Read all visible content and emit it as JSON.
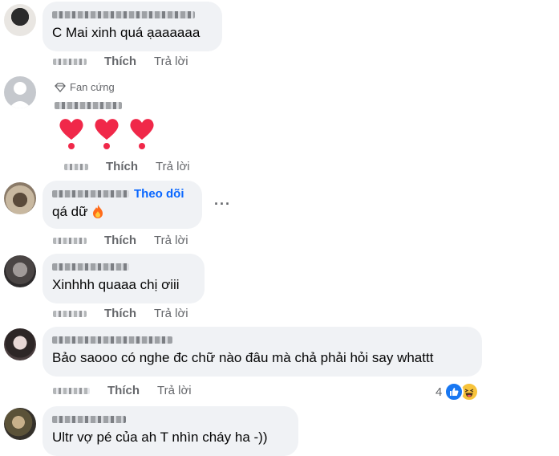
{
  "labels": {
    "like": "Thích",
    "reply": "Trả lời",
    "follow": "Theo dõi",
    "fan_badge": "Fan cứng",
    "more": "···"
  },
  "comments": [
    {
      "text": "C Mai xinh quá ạaaaaaa"
    },
    {
      "text": ""
    },
    {
      "text": "qá dữ"
    },
    {
      "text": "Xinhhh quaaa chị ơiii"
    },
    {
      "text": "Bảo saooo có nghe đc chữ nào đâu mà chả phải hỏi say whattt",
      "reaction_count": "4"
    },
    {
      "text": "Ultr vợ pé của ah T nhìn cháy ha -))"
    }
  ],
  "colors": {
    "bubble": "#f0f2f5",
    "link": "#0866ff",
    "secondary": "#65676b",
    "heart": "#f02849"
  },
  "icons": {
    "reaction_like": "thumbs-up-icon",
    "reaction_haha": "haha-emoji-icon",
    "fire": "fire-emoji",
    "heart": "heart-exclamation-emoji",
    "diamond": "diamond-icon"
  }
}
